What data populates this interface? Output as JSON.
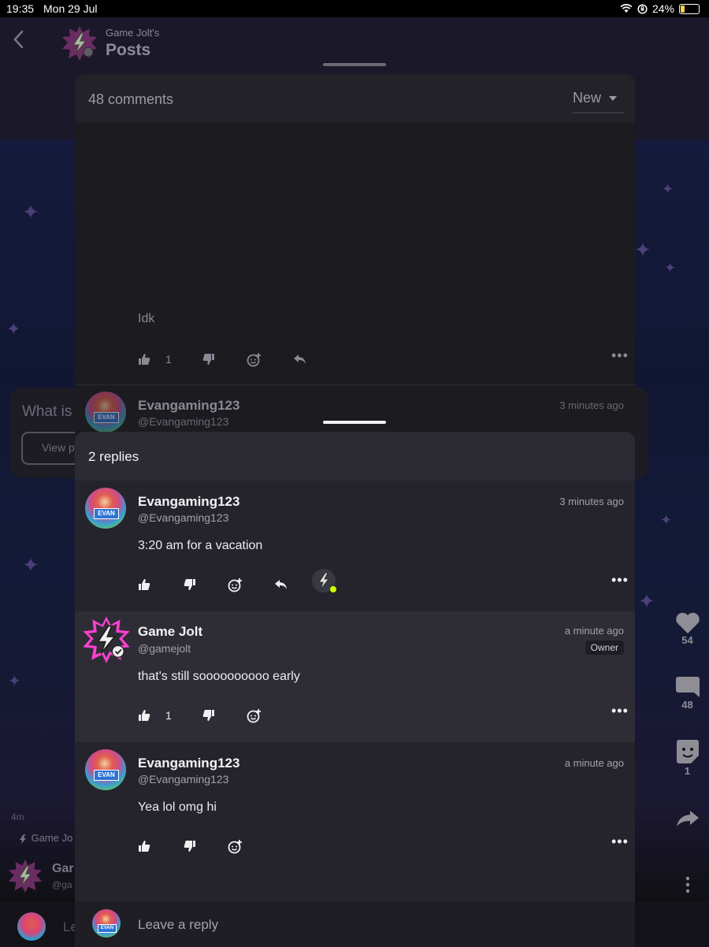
{
  "status_bar": {
    "time": "19:35",
    "date": "Mon 29 Jul",
    "battery": "24%",
    "battery_level": 0.24
  },
  "background_page": {
    "header_subtitle": "Game Jolt's",
    "header_title": "Posts",
    "card_text": "What is",
    "card_button": "View p",
    "side_actions": {
      "likes": "54",
      "comments": "48",
      "stickers": "1"
    },
    "post_age": "4m",
    "post_game": "Game Jo",
    "post_author": "Gar",
    "post_handle": "@ga",
    "reply_placeholder": "Le"
  },
  "comments_sheet": {
    "title": "48 comments",
    "sort_value": "New",
    "dim_comment": {
      "text": "Idk",
      "likes": "1"
    },
    "dim_next": {
      "name": "Evangaming123",
      "handle": "@Evangaming123",
      "time": "3 minutes ago"
    }
  },
  "replies_sheet": {
    "title": "2 replies",
    "parent": {
      "name": "Evangaming123",
      "handle": "@Evangaming123",
      "time": "3 minutes ago",
      "text": "3:20 am for a vacation",
      "avatar_tag": "EVAN"
    },
    "replies": [
      {
        "name": "Game Jolt",
        "handle": "@gamejolt",
        "time": "a minute ago",
        "badge": "Owner",
        "text": "that's still soooooooooo early",
        "likes": "1"
      },
      {
        "name": "Evangaming123",
        "handle": "@Evangaming123",
        "time": "a minute ago",
        "text": "Yea lol omg hi",
        "avatar_tag": "EVAN"
      }
    ],
    "input_placeholder": "Leave a reply"
  },
  "colors": {
    "accent_pink": "#ff3fd0",
    "accent_green": "#ccff00",
    "sheet": "#1b1b20",
    "replies_sheet": "#25242c"
  }
}
